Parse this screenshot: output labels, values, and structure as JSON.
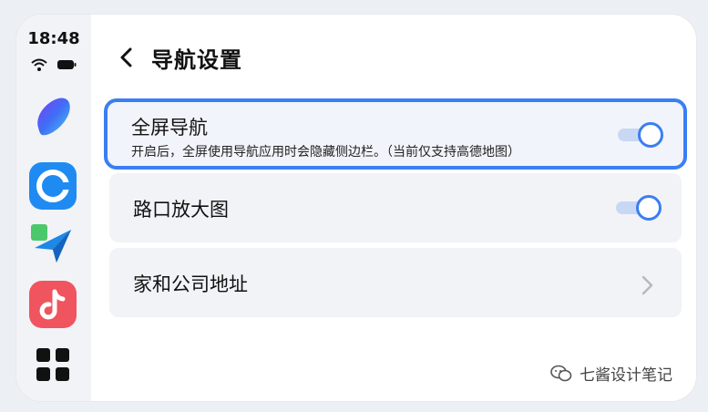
{
  "status": {
    "time": "18:48",
    "wifi_icon": "wifi-icon",
    "battery_icon": "battery-icon"
  },
  "dock": {
    "apps": [
      {
        "name": "assistant-app-icon",
        "color": "#4a6cf7"
      },
      {
        "name": "browser-app-icon",
        "color": "#1f8bf2"
      },
      {
        "name": "navigation-app-icon",
        "color": "#1e88e5"
      },
      {
        "name": "music-app-icon",
        "color": "#f0545e"
      },
      {
        "name": "app-grid-icon",
        "color": "#111111"
      }
    ]
  },
  "header": {
    "title": "导航设置",
    "back_icon": "chevron-left-icon"
  },
  "settings": {
    "fullscreen": {
      "title": "全屏导航",
      "subtitle": "开启后，全屏使用导航应用时会隐藏侧边栏。（当前仅支持高德地图）",
      "enabled": true
    },
    "intersection": {
      "title": "路口放大图",
      "enabled": true
    },
    "address": {
      "title": "家和公司地址",
      "chevron_icon": "chevron-right-icon"
    }
  },
  "footer": {
    "text": "七酱设计笔记",
    "icon": "wechat-icon"
  },
  "colors": {
    "accent": "#3a7ff2",
    "card_bg": "#f2f3f6"
  }
}
